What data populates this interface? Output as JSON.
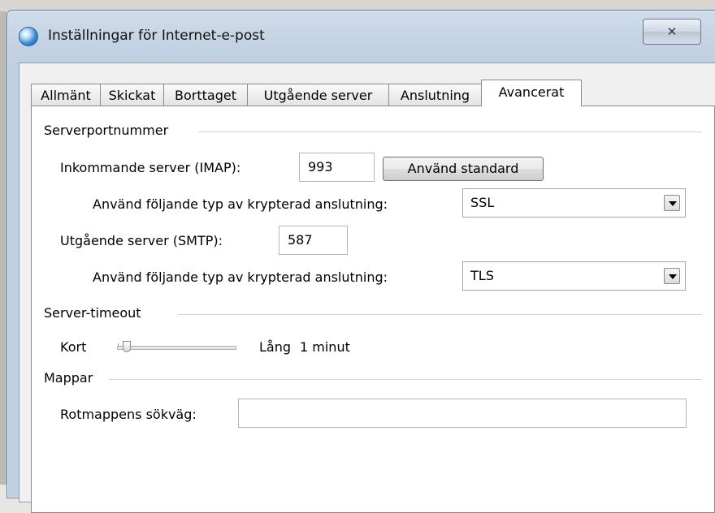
{
  "window": {
    "title": "Inställningar för Internet-e-post",
    "close_glyph": "✕"
  },
  "tabs": [
    {
      "label": "Allmänt",
      "active": false
    },
    {
      "label": "Skickat",
      "active": false
    },
    {
      "label": "Borttaget",
      "active": false
    },
    {
      "label": "Utgående server",
      "active": false
    },
    {
      "label": "Anslutning",
      "active": false
    },
    {
      "label": "Avancerat",
      "active": true
    }
  ],
  "server_ports": {
    "heading": "Serverportnummer",
    "incoming_label": "Inkommande server (IMAP):",
    "incoming_value": "993",
    "default_button": "Använd standard",
    "incoming_encryption_label": "Använd följande typ av krypterad anslutning:",
    "incoming_encryption_value": "SSL",
    "outgoing_label": "Utgående server (SMTP):",
    "outgoing_value": "587",
    "outgoing_encryption_label": "Använd följande typ av krypterad anslutning:",
    "outgoing_encryption_value": "TLS"
  },
  "timeout": {
    "heading": "Server-timeout",
    "short_label": "Kort",
    "long_label": "Lång",
    "value_text": "1 minut",
    "level": 0.05
  },
  "folders": {
    "heading": "Mappar",
    "root_path_label": "Rotmappens sökväg:",
    "root_path_value": ""
  },
  "icons": {
    "app": "globe-mail-icon",
    "close": "close-icon",
    "dropdown": "chevron-down-icon"
  }
}
